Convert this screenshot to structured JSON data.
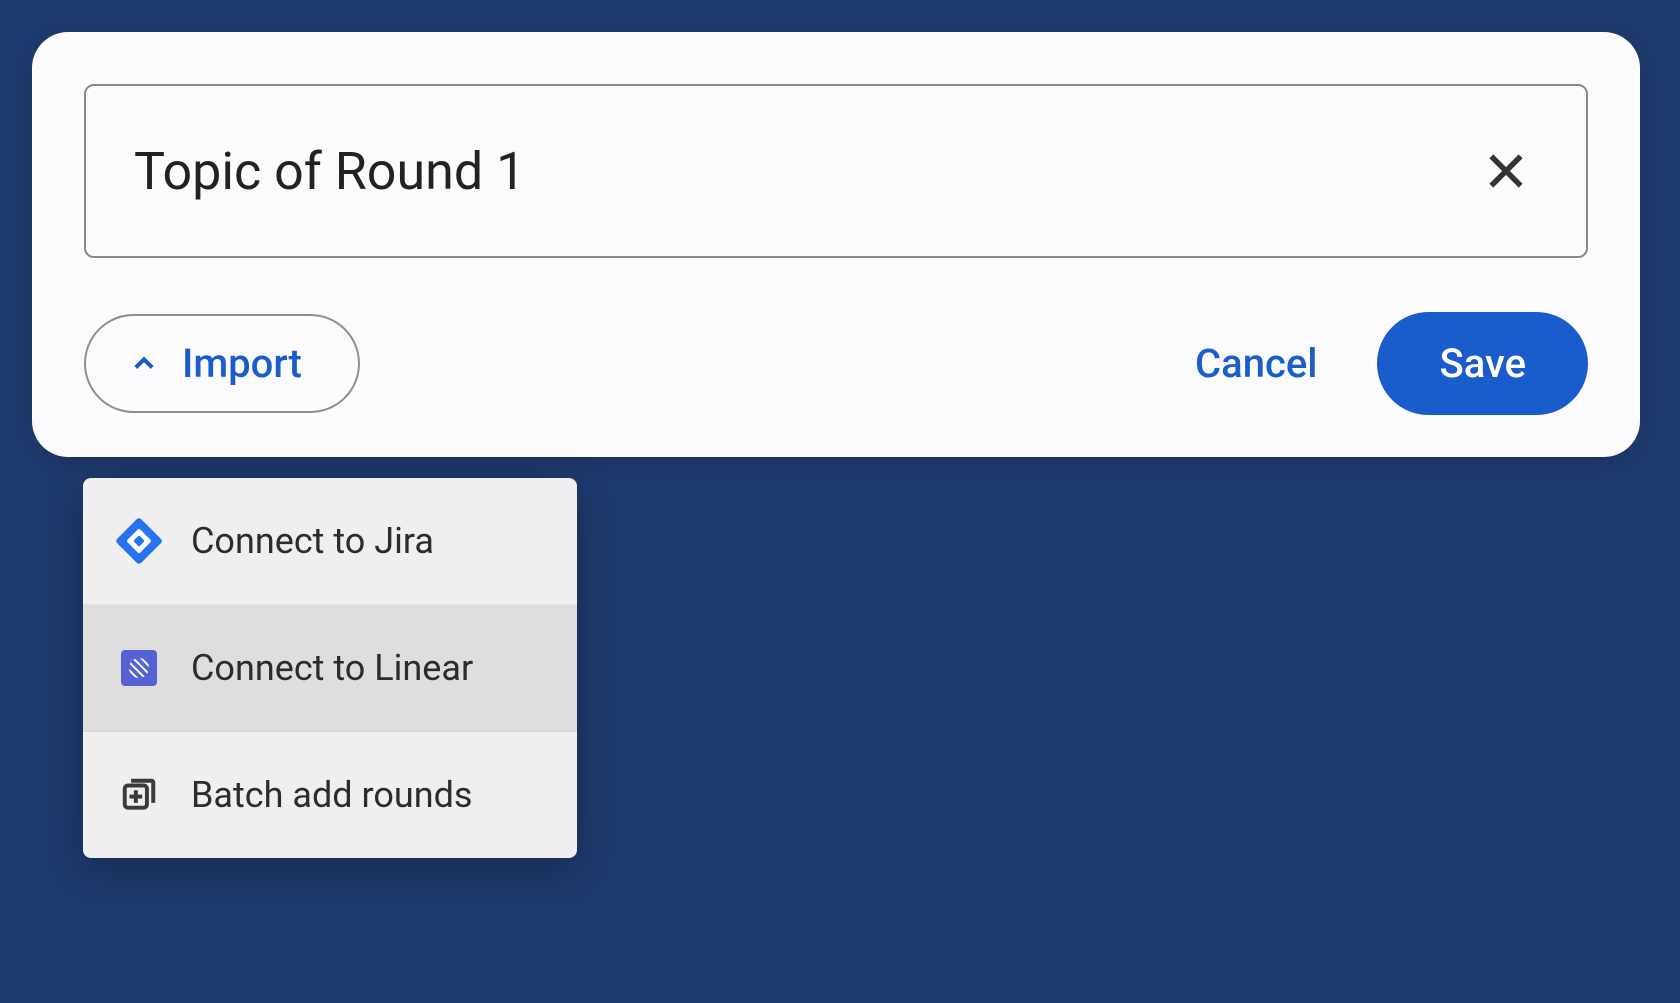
{
  "input": {
    "placeholder": "Topic of Round 1",
    "value": ""
  },
  "buttons": {
    "import": "Import",
    "cancel": "Cancel",
    "save": "Save"
  },
  "dropdown": {
    "items": [
      {
        "label": "Connect to Jira",
        "icon": "jira-icon",
        "hover": false
      },
      {
        "label": "Connect to Linear",
        "icon": "linear-icon",
        "hover": true
      },
      {
        "label": "Batch add rounds",
        "icon": "batch-add-icon",
        "hover": false
      }
    ]
  },
  "colors": {
    "background": "#1f3a6e",
    "accent": "#1a5ccc"
  }
}
